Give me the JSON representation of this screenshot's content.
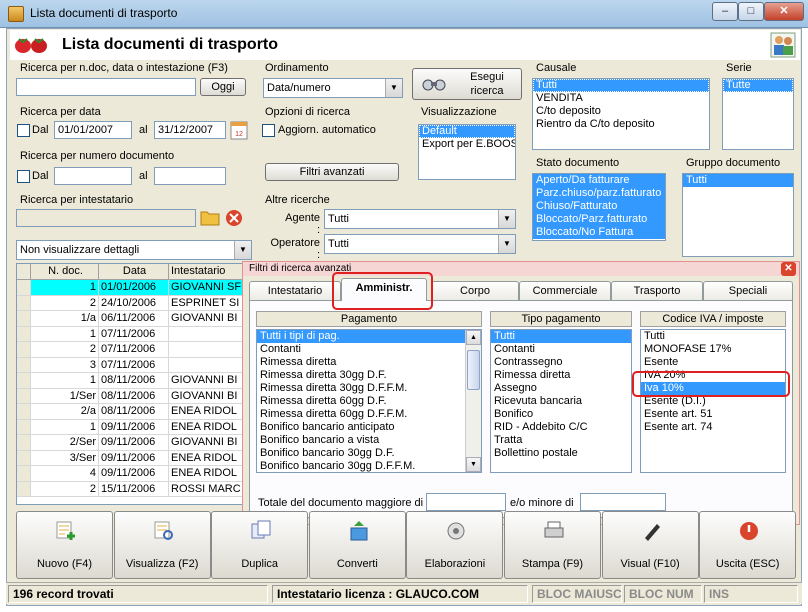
{
  "window": {
    "title": "Lista documenti di trasporto",
    "controls": {
      "minimize": "–",
      "maximize": "□",
      "close": "✕"
    }
  },
  "header": {
    "title": "Lista documenti di trasporto"
  },
  "search_text": {
    "label": "Ricerca per n.doc, data o intestazione (F3)",
    "value": "",
    "button": "Oggi"
  },
  "search_date": {
    "label": "Ricerca per data",
    "from_label": "Dal",
    "from_value": "01/01/2007",
    "to_label": "al",
    "to_value": "31/12/2007"
  },
  "search_number": {
    "label": "Ricerca per numero documento",
    "from_label": "Dal",
    "from_value": "",
    "to_label": "al",
    "to_value": ""
  },
  "search_holder": {
    "label": "Ricerca per intestatario",
    "value": ""
  },
  "details_combo": {
    "value": "Non visualizzare dettagli"
  },
  "ordering": {
    "label": "Ordinamento",
    "value": "Data/numero",
    "execute_button": "Esegui ricerca"
  },
  "search_options": {
    "label": "Opzioni di ricerca",
    "auto_update": "Aggiorn. automatico",
    "advanced_button": "Filtri avanzati"
  },
  "visualization": {
    "label": "Visualizzazione",
    "items": [
      "Default",
      "Export per E.BOOST"
    ],
    "selected": 0
  },
  "other_searches": {
    "label": "Altre ricerche",
    "agent_label": "Agente :",
    "agent_value": "Tutti",
    "operator_label": "Operatore :",
    "operator_value": "Tutti"
  },
  "causale": {
    "label": "Causale",
    "items": [
      "Tutti",
      "VENDITA",
      "C/to deposito",
      "Rientro da C/to deposito"
    ],
    "selected": 0
  },
  "serie": {
    "label": "Serie",
    "items": [
      "Tutte"
    ],
    "selected": 0
  },
  "stato_documento": {
    "label": "Stato documento",
    "items": [
      "Aperto/Da fatturare",
      "Parz.chiuso/parz.fatturato",
      "Chiuso/Fatturato",
      "Bloccato/Parz.fatturato",
      "Bloccato/No Fattura"
    ]
  },
  "gruppo_documento": {
    "label": "Gruppo documento",
    "items": [
      "Tutti"
    ]
  },
  "grid": {
    "columns": [
      "",
      "N. doc.",
      "Data",
      "Intestatario"
    ],
    "rows": [
      {
        "num": "1",
        "date": "01/01/2006",
        "holder": "GIOVANNI SF",
        "highlight": true
      },
      {
        "num": "2",
        "date": "24/10/2006",
        "holder": "ESPRINET SI",
        "highlight": false
      },
      {
        "num": "1/a",
        "date": "06/11/2006",
        "holder": "GIOVANNI BI",
        "highlight": false
      },
      {
        "num": "1",
        "date": "07/11/2006",
        "holder": "",
        "highlight": false
      },
      {
        "num": "2",
        "date": "07/11/2006",
        "holder": "",
        "highlight": false
      },
      {
        "num": "3",
        "date": "07/11/2006",
        "holder": "",
        "highlight": false
      },
      {
        "num": "1",
        "date": "08/11/2006",
        "holder": "GIOVANNI BI",
        "highlight": false
      },
      {
        "num": "1/Ser",
        "date": "08/11/2006",
        "holder": "GIOVANNI BI",
        "highlight": false
      },
      {
        "num": "2/a",
        "date": "08/11/2006",
        "holder": "ENEA RIDOL",
        "highlight": false
      },
      {
        "num": "1",
        "date": "09/11/2006",
        "holder": "ENEA RIDOL",
        "highlight": false
      },
      {
        "num": "2/Ser",
        "date": "09/11/2006",
        "holder": "GIOVANNI BI",
        "highlight": false
      },
      {
        "num": "3/Ser",
        "date": "09/11/2006",
        "holder": "ENEA RIDOL",
        "highlight": false
      },
      {
        "num": "4",
        "date": "09/11/2006",
        "holder": "ENEA RIDOL",
        "highlight": false
      },
      {
        "num": "2",
        "date": "15/11/2006",
        "holder": "ROSSI MARC",
        "highlight": false
      }
    ]
  },
  "advanced_panel": {
    "title": "Filtri di ricerca avanzati",
    "close": "✕",
    "tabs": [
      "Intestatario",
      "Amministr.",
      "Corpo",
      "Commerciale",
      "Trasporto",
      "Speciali"
    ],
    "active_tab": 1,
    "pagamento": {
      "header": "Pagamento",
      "items": [
        "Tutti i tipi di pag.",
        "Contanti",
        "Rimessa diretta",
        "Rimessa diretta 30gg D.F.",
        "Rimessa diretta 30gg D.F.F.M.",
        "Rimessa diretta 60gg D.F.",
        "Rimessa diretta 60gg D.F.F.M.",
        "Bonifico bancario anticipato",
        "Bonifico bancario a vista",
        "Bonifico bancario 30gg D.F.",
        "Bonifico bancario 30gg D.F.F.M."
      ],
      "selected": 0
    },
    "tipo_pagamento": {
      "header": "Tipo pagamento",
      "items": [
        "Tutti",
        "Contanti",
        "Contrassegno",
        "Rimessa diretta",
        "Assegno",
        "Ricevuta bancaria",
        "Bonifico",
        "RID - Addebito C/C",
        "Tratta",
        "Bollettino postale"
      ],
      "selected": 0
    },
    "codice_iva": {
      "header": "Codice IVA / imposte",
      "items": [
        "Tutti",
        "MONOFASE 17%",
        "Esente",
        "IVA 20%",
        "Iva 10%",
        "Esente (D.I.)",
        "Esente art. 51",
        "Esente art. 74"
      ],
      "selected": 4
    },
    "total_gt_label": "Totale del documento maggiore di",
    "total_gt_value": "",
    "total_lt_label": "e/o minore di",
    "total_lt_value": ""
  },
  "toolbar": [
    {
      "label": "Nuovo (F4)",
      "icon": "new-document-icon"
    },
    {
      "label": "Visualizza (F2)",
      "icon": "view-document-icon"
    },
    {
      "label": "Duplica",
      "icon": "duplicate-icon"
    },
    {
      "label": "Converti",
      "icon": "convert-icon"
    },
    {
      "label": "Elaborazioni",
      "icon": "processing-icon"
    },
    {
      "label": "Stampa (F9)",
      "icon": "printer-icon"
    },
    {
      "label": "Visual (F10)",
      "icon": "pen-icon"
    },
    {
      "label": "Uscita (ESC)",
      "icon": "exit-icon"
    }
  ],
  "status": {
    "records": "196 record trovati",
    "license": "Intestatario licenza : GLAUCO.COM",
    "caps": "BLOC MAIUSC",
    "num": "BLOC NUM",
    "ins": "INS"
  },
  "colors": {
    "selection": "#3399ff",
    "row_highlight": "#00ffff",
    "annotation_red": "#e02020"
  }
}
